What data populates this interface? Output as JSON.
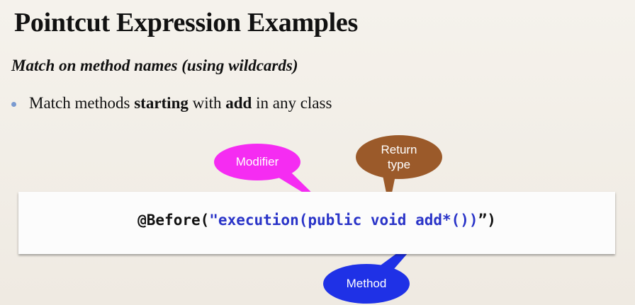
{
  "slide": {
    "title": "Pointcut Expression Examples",
    "subtitle": "Match on method names (using wildcards)",
    "bullet": {
      "pre": "Match methods ",
      "bold1": "starting",
      "mid": " with ",
      "bold2": "add",
      "post": " in any class"
    },
    "code": {
      "annotation": "@Before(",
      "string": "\"execution(public void add*())",
      "closing": "”)"
    },
    "callouts": {
      "modifier": "Modifier",
      "return_type_line1": "Return",
      "return_type_line2": "type",
      "method": "Method"
    },
    "colors": {
      "modifier": "#f52cf2",
      "return_type": "#9b5a2a",
      "method": "#1f31e6",
      "code_string": "#2a34c8"
    }
  }
}
